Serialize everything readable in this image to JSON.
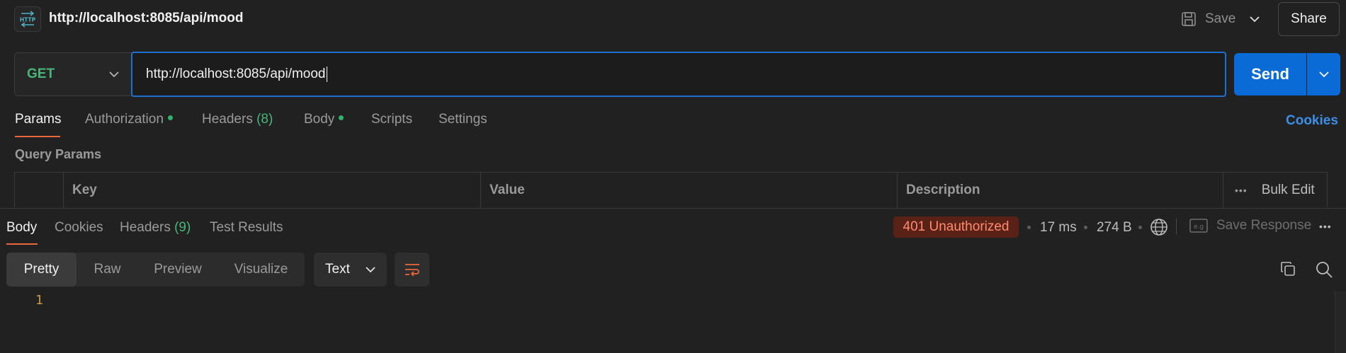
{
  "header": {
    "icon_text": "HTTP",
    "title": "http://localhost:8085/api/mood",
    "save_label": "Save",
    "share_label": "Share"
  },
  "request": {
    "method": "GET",
    "url": "http://localhost:8085/api/mood",
    "send_label": "Send"
  },
  "request_tabs": {
    "params": "Params",
    "authorization": "Authorization",
    "headers": "Headers",
    "headers_count": "(8)",
    "body": "Body",
    "scripts": "Scripts",
    "settings": "Settings",
    "cookies": "Cookies"
  },
  "query_params": {
    "title": "Query Params",
    "columns": [
      "Key",
      "Value",
      "Description"
    ],
    "bulk_edit": "Bulk Edit"
  },
  "response_tabs": {
    "body": "Body",
    "cookies": "Cookies",
    "headers": "Headers",
    "headers_count": "(9)",
    "test_results": "Test Results"
  },
  "response_meta": {
    "status": "401 Unauthorized",
    "time": "17 ms",
    "size": "274 B",
    "save_response": "Save Response"
  },
  "view": {
    "modes": [
      "Pretty",
      "Raw",
      "Preview",
      "Visualize"
    ],
    "active_mode": "Pretty",
    "format": "Text"
  },
  "editor": {
    "line_numbers": [
      "1"
    ]
  },
  "colors": {
    "accent": "#e9663c",
    "method_get": "#49b679",
    "send": "#0b6bd6",
    "status_error_bg": "#5a2116",
    "status_error_text": "#ff8a70",
    "link": "#3d8ee6"
  }
}
